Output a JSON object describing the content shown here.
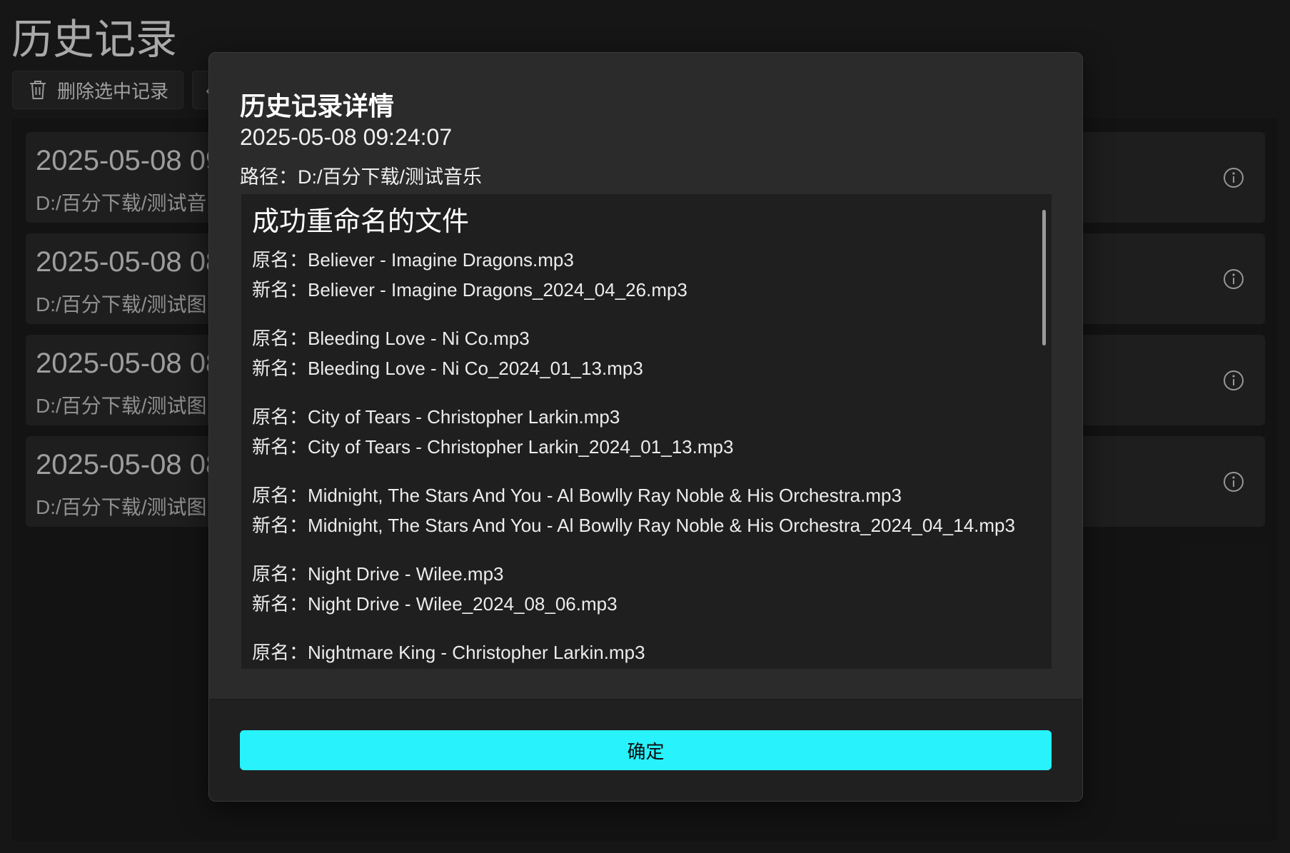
{
  "page": {
    "title": "历史记录"
  },
  "toolbar": {
    "delete_label": "删除选中记录",
    "second_partial": "‹"
  },
  "records": [
    {
      "time": "2025-05-08 09",
      "path": "D:/百分下载/测试音"
    },
    {
      "time": "2025-05-08 08",
      "path": "D:/百分下载/测试图"
    },
    {
      "time": "2025-05-08 08",
      "path": "D:/百分下载/测试图"
    },
    {
      "time": "2025-05-08 08",
      "path": "D:/百分下载/测试图"
    }
  ],
  "dialog": {
    "title": "历史记录详情",
    "time": "2025-05-08 09:24:07",
    "path_line": "路径：D:/百分下载/测试音乐",
    "section_heading": "成功重命名的文件",
    "files": [
      {
        "old": "原名：Believer - Imagine Dragons.mp3",
        "new": "新名：Believer - Imagine Dragons_2024_04_26.mp3"
      },
      {
        "old": "原名：Bleeding Love - Ni Co.mp3",
        "new": "新名：Bleeding Love - Ni Co_2024_01_13.mp3"
      },
      {
        "old": "原名：City of Tears - Christopher Larkin.mp3",
        "new": "新名：City of Tears - Christopher Larkin_2024_01_13.mp3"
      },
      {
        "old": "原名：Midnight, The Stars And You - Al Bowlly Ray Noble & His Orchestra.mp3",
        "new": "新名：Midnight, The Stars And You - Al Bowlly Ray Noble & His Orchestra_2024_04_14.mp3"
      },
      {
        "old": "原名：Night Drive - Wilee.mp3",
        "new": "新名：Night Drive - Wilee_2024_08_06.mp3"
      },
      {
        "old": "原名：Nightmare King - Christopher Larkin.mp3"
      }
    ],
    "ok_label": "确定"
  },
  "colors": {
    "accent": "#28f2fc",
    "background": "#202020",
    "card": "#2b2b2b"
  }
}
